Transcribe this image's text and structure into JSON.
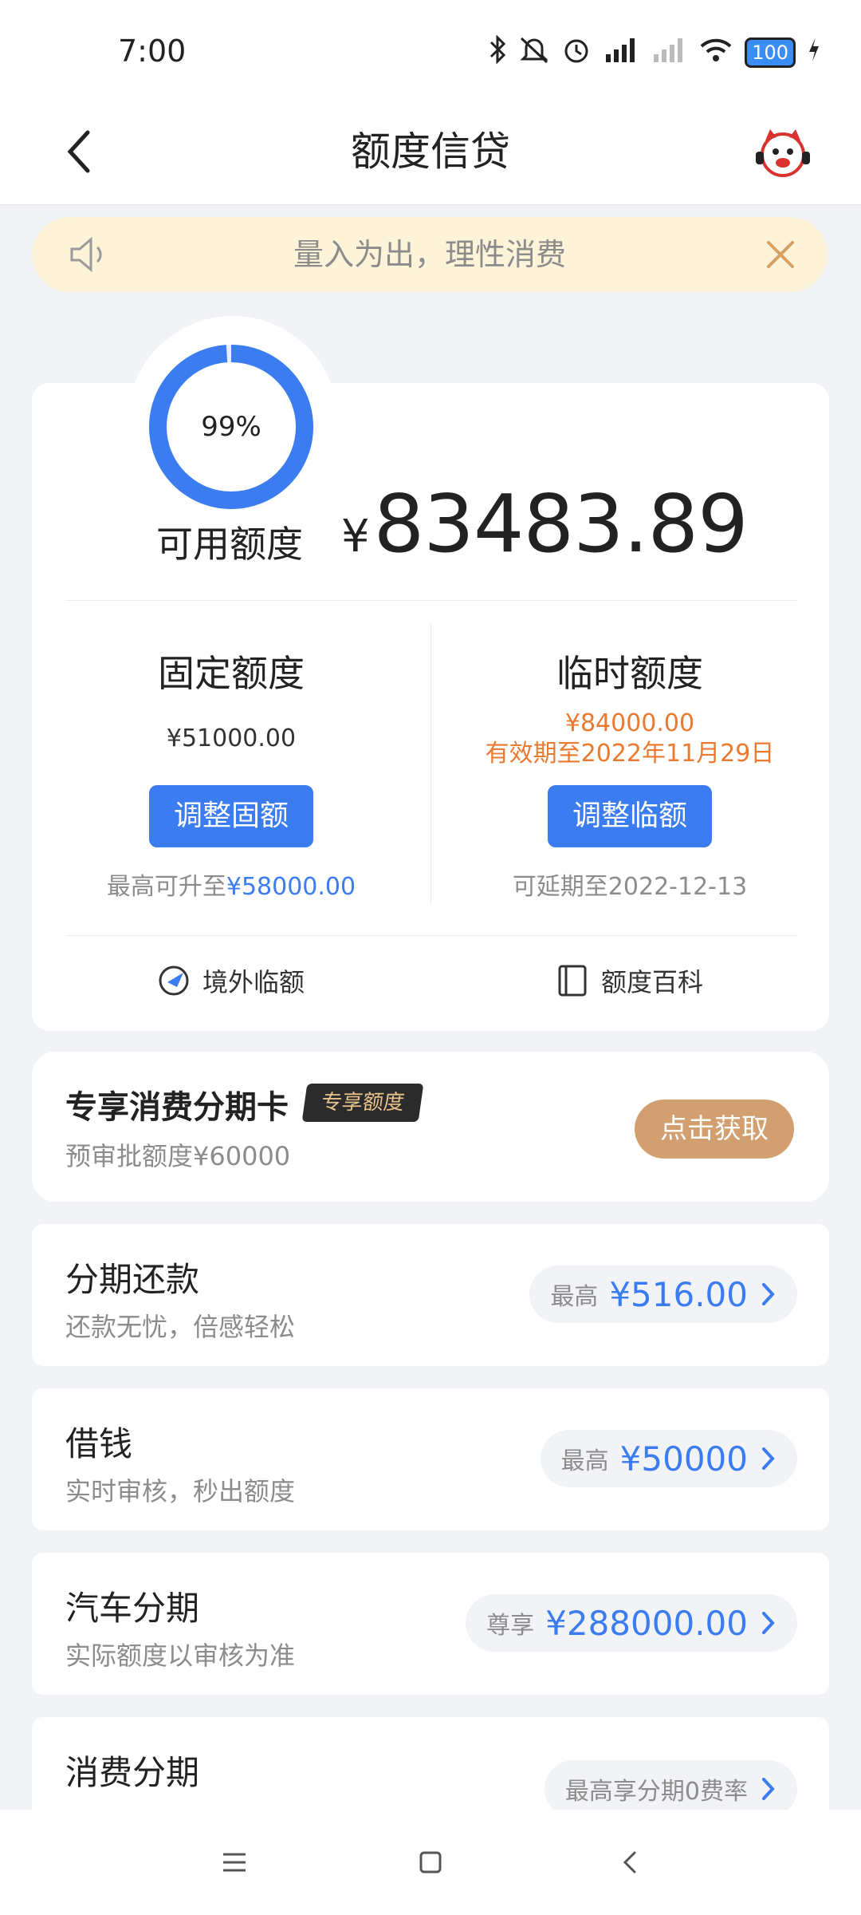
{
  "status_bar": {
    "time": "7:00",
    "battery": "100",
    "icons": [
      "bluetooth-icon",
      "mute-icon",
      "alarm-icon",
      "hd-signal-icon",
      "signal-icon",
      "wifi-icon",
      "charging-icon"
    ]
  },
  "header": {
    "title": "额度信贷",
    "back_icon": "chevron-left-icon",
    "mascot_icon": "mascot-icon"
  },
  "notice": {
    "text": "量入为出，理性消费"
  },
  "credit": {
    "gauge_percent": 99,
    "gauge_label": "99%",
    "available_label": "可用额度",
    "currency": "¥",
    "available_amount": "83483.89",
    "fixed": {
      "title": "固定额度",
      "amount": "¥51000.00",
      "button": "调整固额",
      "foot_prefix": "最高可升至",
      "foot_amount": "¥58000.00"
    },
    "temp": {
      "title": "临时额度",
      "amount": "¥84000.00",
      "validity": "有效期至2022年11月29日",
      "button": "调整临额",
      "foot": "可延期至2022-12-13"
    },
    "links": {
      "overseas": "境外临额",
      "wiki": "额度百科"
    }
  },
  "exclusive": {
    "title": "专享消费分期卡",
    "badge": "专享额度",
    "subtitle": "预审批额度¥60000",
    "button": "点击获取"
  },
  "services": [
    {
      "title": "分期还款",
      "subtitle": "还款无忧，倍感轻松",
      "prefix": "最高",
      "amount": "¥516.00"
    },
    {
      "title": "借钱",
      "subtitle": "实时审核，秒出额度",
      "prefix": "最高",
      "amount": "¥50000"
    },
    {
      "title": "汽车分期",
      "subtitle": "实际额度以审核为准",
      "prefix": "尊享",
      "amount": "¥288000.00"
    },
    {
      "title": "消费分期",
      "subtitle": "",
      "prefix": "最高享分期0费率",
      "amount": ""
    }
  ],
  "colors": {
    "accent_blue": "#3b7cf0",
    "orange": "#ea7a30",
    "gold": "#d2a070",
    "notice_bg": "#fcf3d9"
  }
}
